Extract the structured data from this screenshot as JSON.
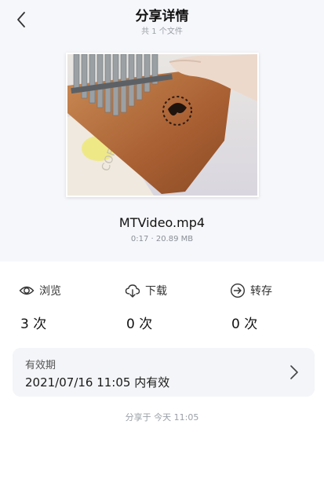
{
  "header": {
    "title": "分享详情",
    "subtitle": "共 1 个文件",
    "back_icon": "chevron-left-icon"
  },
  "file": {
    "name": "MTVideo.mp4",
    "meta": "0:17 · 20.89 MB"
  },
  "stats": [
    {
      "label": "浏览",
      "value": "3 次",
      "icon": "eye-icon"
    },
    {
      "label": "下载",
      "value": "0 次",
      "icon": "cloud-download-icon"
    },
    {
      "label": "转存",
      "value": "0 次",
      "icon": "arrow-circle-icon"
    }
  ],
  "validity": {
    "label": "有效期",
    "value": "2021/07/16 11:05 内有效",
    "icon": "chevron-right-icon"
  },
  "shared_at": "分享于  今天 11:05",
  "colors": {
    "top_background": "#f6f7fb",
    "card_background": "#f4f5f8",
    "wood": "#b06a3c"
  }
}
